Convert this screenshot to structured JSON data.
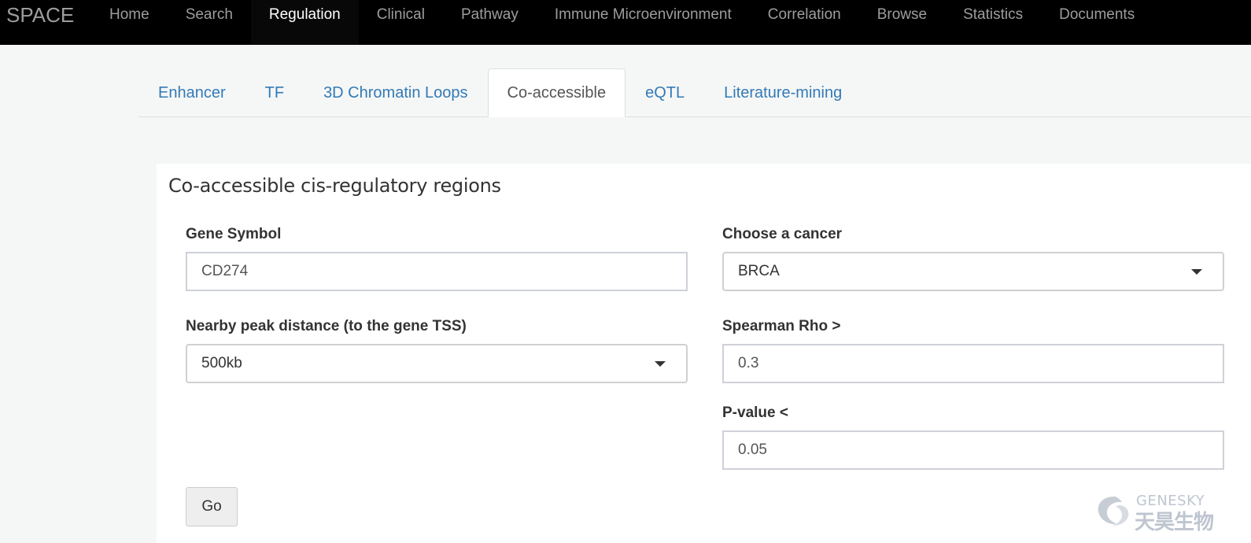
{
  "navbar": {
    "brand": "SPACE",
    "items": [
      {
        "label": "Home"
      },
      {
        "label": "Search"
      },
      {
        "label": "Regulation"
      },
      {
        "label": "Clinical"
      },
      {
        "label": "Pathway"
      },
      {
        "label": "Immune Microenvironment"
      },
      {
        "label": "Correlation"
      },
      {
        "label": "Browse"
      },
      {
        "label": "Statistics"
      },
      {
        "label": "Documents"
      }
    ],
    "active": "Regulation"
  },
  "tabs": {
    "items": [
      {
        "label": "Enhancer"
      },
      {
        "label": "TF"
      },
      {
        "label": "3D Chromatin Loops"
      },
      {
        "label": "Co-accessible"
      },
      {
        "label": "eQTL"
      },
      {
        "label": "Literature-mining"
      }
    ],
    "active": "Co-accessible"
  },
  "panel": {
    "title": "Co-accessible cis-regulatory regions",
    "gene_symbol": {
      "label": "Gene Symbol",
      "value": "CD274"
    },
    "cancer": {
      "label": "Choose a cancer",
      "value": "BRCA"
    },
    "distance": {
      "label": "Nearby peak distance (to the gene TSS)",
      "value": "500kb"
    },
    "rho": {
      "label": "Spearman Rho >",
      "value": "0.3"
    },
    "pvalue": {
      "label": "P-value <",
      "value": "0.05"
    },
    "go_label": "Go"
  },
  "watermark": {
    "en": "GENESKY",
    "cn": "天昊生物"
  },
  "colors": {
    "navbar_bg": "#000000",
    "link": "#337ab7",
    "page_bg": "#f5f7f6"
  }
}
